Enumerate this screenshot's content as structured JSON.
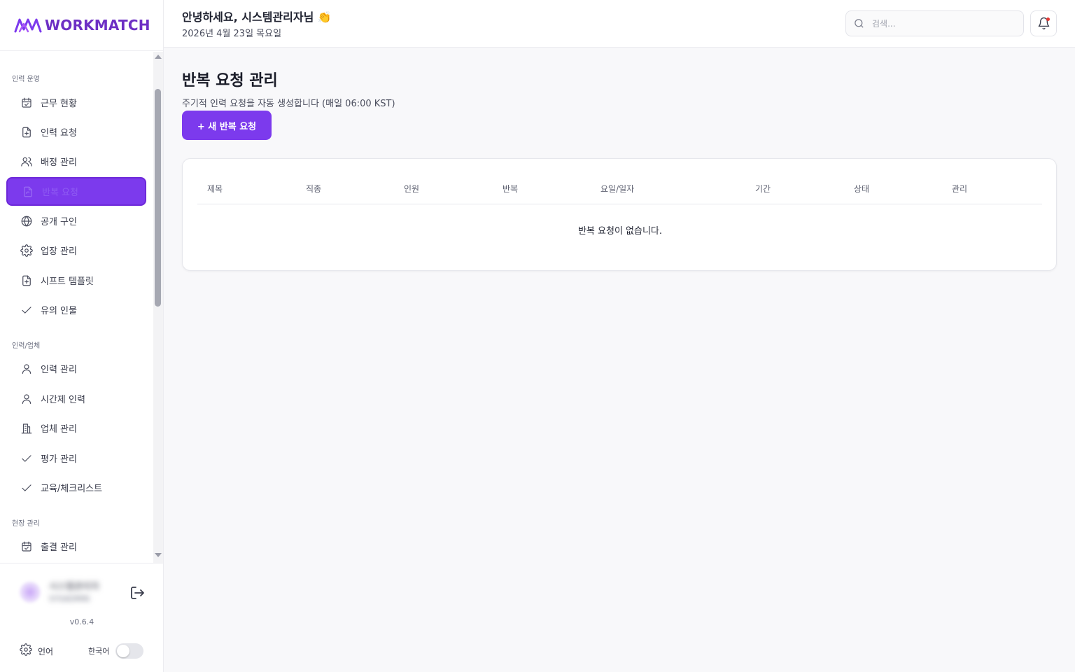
{
  "app": {
    "logo_text": "WORKMATCH"
  },
  "sidebar": {
    "sections": [
      {
        "label": "인력 운영"
      },
      {
        "label": "인력/업체"
      },
      {
        "label": "현장 관리"
      }
    ],
    "items": [
      {
        "label": "근무 현황",
        "icon": "calendar-check-icon"
      },
      {
        "label": "인력 요청",
        "icon": "file-plus-icon"
      },
      {
        "label": "배정 관리",
        "icon": "users-icon"
      },
      {
        "label": "반복 요청",
        "icon": "file-repeat-icon",
        "active": true
      },
      {
        "label": "공개 구인",
        "icon": "globe-icon"
      },
      {
        "label": "업장 관리",
        "icon": "gear-icon"
      },
      {
        "label": "시프트 템플릿",
        "icon": "file-plus-icon"
      },
      {
        "label": "유의 인물",
        "icon": "check-icon"
      },
      {
        "label": "인력 관리",
        "icon": "user-icon"
      },
      {
        "label": "시간제 인력",
        "icon": "user-icon"
      },
      {
        "label": "업체 관리",
        "icon": "building-icon"
      },
      {
        "label": "평가 관리",
        "icon": "check-icon"
      },
      {
        "label": "교육/체크리스트",
        "icon": "check-icon"
      },
      {
        "label": "출결 관리",
        "icon": "calendar-check-icon"
      }
    ],
    "footer": {
      "user_name": "시스템관리자",
      "user_role": "SYSADMIN",
      "version": "v0.6.4",
      "language_label": "언어",
      "language_value": "한국어"
    }
  },
  "header": {
    "greeting": "안녕하세요, 시스템관리자님 👏",
    "date": "2026년 4월 23일 목요일",
    "search_placeholder": "검색..."
  },
  "main": {
    "title": "반복 요청 관리",
    "subtitle": "주기적 인력 요청을 자동 생성합니다 (매일 06:00 KST)",
    "new_button": "+ 새 반복 요청",
    "table": {
      "columns": [
        "제목",
        "직종",
        "인원",
        "반복",
        "요일/일자",
        "기간",
        "상태",
        "관리"
      ],
      "empty_message": "반복 요청이 없습니다."
    }
  },
  "colors": {
    "accent": "#7c3aed",
    "logo": "#6d2fc4"
  }
}
